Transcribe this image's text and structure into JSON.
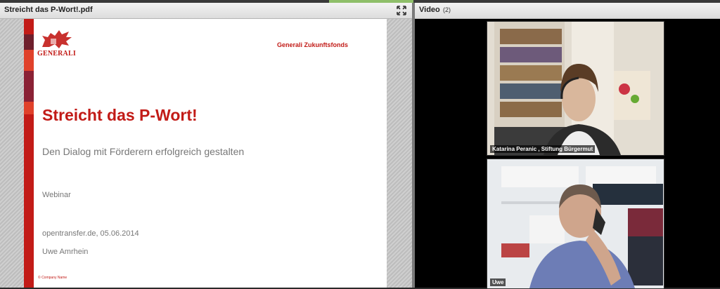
{
  "document_pod": {
    "title": "Streicht das P-Wort!.pdf",
    "fullscreen_icon": "fullscreen-icon",
    "slide": {
      "logo_text": "GENERALI",
      "brand_right": "Generali Zukunftsfonds",
      "title": "Streicht das P-Wort!",
      "subtitle": "Den Dialog mit Förderern erfolgreich gestalten",
      "webinar": "Webinar",
      "date_line": "opentransfer.de, 05.06.2014",
      "author": "Uwe Amrhein",
      "footer": "© Company Name",
      "brand_color": "#c21b17"
    }
  },
  "video_pod": {
    "title": "Video",
    "count": "(2)",
    "participants": [
      {
        "name": "Katarina Peranic , Stiftung Bürgermut"
      },
      {
        "name": "Uwe"
      }
    ]
  }
}
